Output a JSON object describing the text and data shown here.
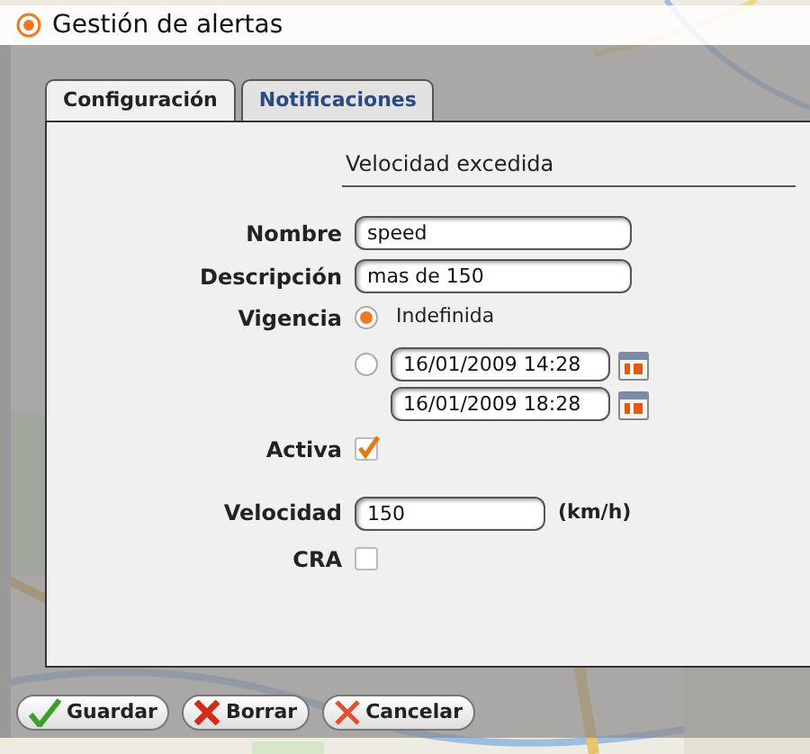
{
  "window": {
    "title": "Gestión de alertas"
  },
  "tabs": [
    {
      "label": "Configuración",
      "selected": true
    },
    {
      "label": "Notificaciones",
      "selected": false
    }
  ],
  "section_title": "Velocidad excedida",
  "form": {
    "nombre": {
      "label": "Nombre",
      "value": "speed"
    },
    "descripcion": {
      "label": "Descripción",
      "value": "mas de 150"
    },
    "vigencia": {
      "label": "Vigencia",
      "options": [
        {
          "kind": "text",
          "label": "Indefinida",
          "selected": true
        },
        {
          "kind": "dates",
          "from": "16/01/2009 14:28",
          "to": "16/01/2009 18:28",
          "selected": false
        }
      ]
    },
    "activa": {
      "label": "Activa",
      "checked": true
    },
    "velocidad": {
      "label": "Velocidad",
      "value": "150",
      "unit": "(km/h)"
    },
    "cra": {
      "label": "CRA",
      "checked": false
    }
  },
  "buttons": [
    {
      "kind": "save",
      "label": "Guardar"
    },
    {
      "kind": "delete",
      "label": "Borrar"
    },
    {
      "kind": "cancel",
      "label": "Cancelar"
    }
  ]
}
